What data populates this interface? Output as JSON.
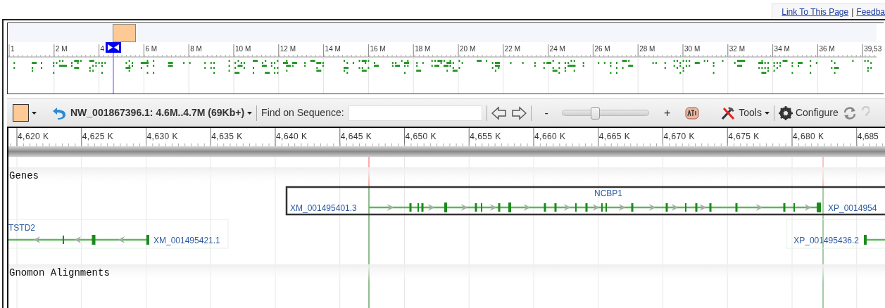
{
  "header_links": [
    {
      "label": "Link To This Page"
    },
    {
      "label": "Feedba"
    }
  ],
  "header_separator": "|",
  "overview": {
    "ruler_labels": [
      "1",
      "2 M",
      "4",
      "6 M",
      "8 M",
      "10 M",
      "12 M",
      "14 M",
      "16 M",
      "18 M",
      "20 M",
      "22 M",
      "24 M",
      "26 M",
      "28 M",
      "30 M",
      "32 M",
      "34 M",
      "36 M",
      "39,53"
    ]
  },
  "toolbar": {
    "title": "NW_001867396.1: 4.6M..4.7M (69Kb+)",
    "find_label": "Find on Sequence:",
    "zoom_out": "-",
    "zoom": {
      "level": 0.36
    },
    "zoom_in": "+",
    "tools": "Tools",
    "configure": "Configure"
  },
  "ruler": {
    "labels": [
      "4,620 K",
      "4,625 K",
      "4,630 K",
      "4,635 K",
      "4,640 K",
      "4,645 K",
      "4,650 K",
      "4,655 K",
      "4,660 K",
      "4,665 K",
      "4,670 K",
      "4,675 K",
      "4,680 K",
      "4,685"
    ]
  },
  "tracks": [
    {
      "title": "Genes",
      "features": [
        {
          "name": "NCBP1",
          "label": "XM_001495401.3",
          "right_label": "XP_0014954",
          "selected": true
        },
        {
          "name": "TSTD2",
          "label": "XM_001495421.1",
          "selected": false
        },
        {
          "label": "XP_001495436.2",
          "selected": false
        }
      ]
    },
    {
      "title": "Gnomon Alignments"
    }
  ]
}
